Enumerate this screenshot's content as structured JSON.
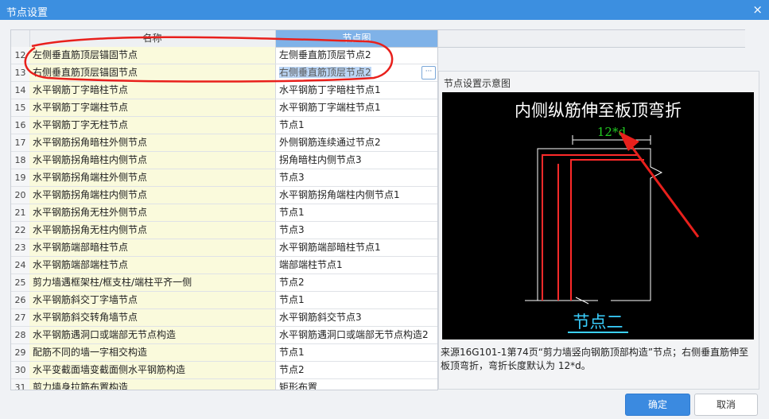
{
  "window": {
    "title": "节点设置",
    "close_glyph": "×"
  },
  "grid": {
    "headers": {
      "name": "名称",
      "node": "节点图"
    },
    "selected_index": 1,
    "rows": [
      {
        "idx": "12",
        "name": "左侧垂直筋顶层锚固节点",
        "node": "左侧垂直筋顶层节点2"
      },
      {
        "idx": "13",
        "name": "右侧垂直筋顶层锚固节点",
        "node": "右侧垂直筋顶层节点2"
      },
      {
        "idx": "14",
        "name": "水平钢筋丁字暗柱节点",
        "node": "水平钢筋丁字暗柱节点1"
      },
      {
        "idx": "15",
        "name": "水平钢筋丁字端柱节点",
        "node": "水平钢筋丁字端柱节点1"
      },
      {
        "idx": "16",
        "name": "水平钢筋丁字无柱节点",
        "node": "节点1"
      },
      {
        "idx": "17",
        "name": "水平钢筋拐角暗柱外侧节点",
        "node": "外侧钢筋连续通过节点2"
      },
      {
        "idx": "18",
        "name": "水平钢筋拐角暗柱内侧节点",
        "node": "拐角暗柱内侧节点3"
      },
      {
        "idx": "19",
        "name": "水平钢筋拐角端柱外侧节点",
        "node": "节点3"
      },
      {
        "idx": "20",
        "name": "水平钢筋拐角端柱内侧节点",
        "node": "水平钢筋拐角端柱内侧节点1"
      },
      {
        "idx": "21",
        "name": "水平钢筋拐角无柱外侧节点",
        "node": "节点1"
      },
      {
        "idx": "22",
        "name": "水平钢筋拐角无柱内侧节点",
        "node": "节点3"
      },
      {
        "idx": "23",
        "name": "水平钢筋端部暗柱节点",
        "node": "水平钢筋端部暗柱节点1"
      },
      {
        "idx": "24",
        "name": "水平钢筋端部端柱节点",
        "node": "端部端柱节点1"
      },
      {
        "idx": "25",
        "name": "剪力墙遇框架柱/框支柱/端柱平齐一侧",
        "node": "节点2"
      },
      {
        "idx": "26",
        "name": "水平钢筋斜交丁字墙节点",
        "node": "节点1"
      },
      {
        "idx": "27",
        "name": "水平钢筋斜交转角墙节点",
        "node": "水平钢筋斜交节点3"
      },
      {
        "idx": "28",
        "name": "水平钢筋遇洞口或端部无节点构造",
        "node": "水平钢筋遇洞口或端部无节点构造2"
      },
      {
        "idx": "29",
        "name": "配筋不同的墙一字相交构造",
        "node": "节点1"
      },
      {
        "idx": "30",
        "name": "水平变截面墙变截面侧水平钢筋构造",
        "node": "节点2"
      },
      {
        "idx": "31",
        "name": "剪力墙身拉筋布置构造",
        "node": "矩形布置"
      }
    ],
    "ellipsis_glyph": "···"
  },
  "preview": {
    "title": "节点设置示意图",
    "diagram_heading": "内侧纵筋伸至板顶弯折",
    "dimension_label": "12*d",
    "node_caption": "节点二",
    "description": "来源16G101-1第74页“剪力墙竖向钢筋顶部构造”节点；右侧垂直筋伸至板顶弯折，弯折长度默认为 12*d。",
    "colors": {
      "background": "#000000",
      "rebar": "#ff2a2a",
      "outline": "#ffffff",
      "dimension": "#22cc22",
      "caption": "#3ad0ff"
    }
  },
  "buttons": {
    "ok": "确定",
    "cancel": "取消"
  },
  "colors": {
    "titlebar": "#3c8fe0",
    "primary_button": "#3b8ae0",
    "annotation": "#e8201c"
  }
}
